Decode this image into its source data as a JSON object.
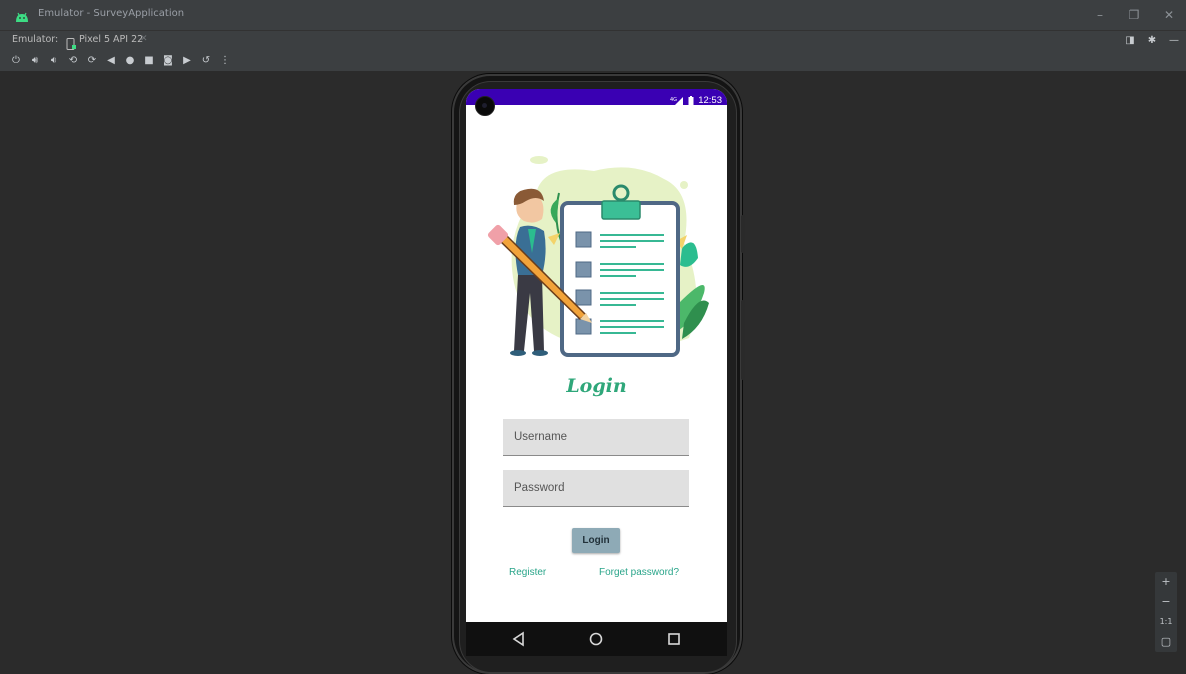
{
  "window": {
    "title": "Emulator - SurveyApplication"
  },
  "emulator_bar": {
    "label": "Emulator:",
    "tab_label": "Pixel 5 API 22"
  },
  "device": {
    "status_time": "12:53",
    "status_network": "4G"
  },
  "app": {
    "title": "Login",
    "username_placeholder": "Username",
    "password_placeholder": "Password",
    "login_button": "Login",
    "register_link": "Register",
    "forget_link": "Forget password?"
  },
  "zoom": {
    "plus": "+",
    "minus": "−",
    "one_to_one": "1:1"
  },
  "colors": {
    "accent": "#2fa77a",
    "status_bar": "#3a00b3",
    "login_button": "#8eaab6",
    "field_bg": "#e0e0e0"
  }
}
